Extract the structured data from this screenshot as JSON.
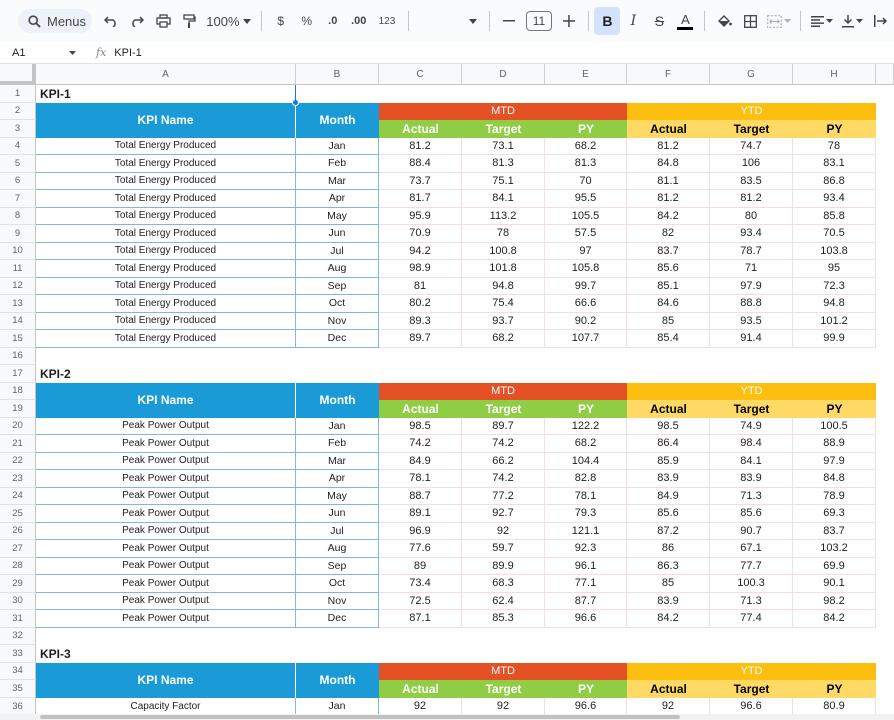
{
  "toolbar": {
    "menus_label": "Menus",
    "zoom": "100%",
    "currency": "$",
    "percent": "%",
    "dec_decrease": ".0",
    "dec_increase": ".00",
    "num_format": "123",
    "font_size": "11",
    "bold": "B",
    "italic": "I",
    "strike": "S",
    "text_color": "A",
    "icons": [
      "search-icon",
      "undo-icon",
      "redo-icon",
      "print-icon",
      "paint-format-icon",
      "zoom-dropdown-icon",
      "font-dropdown-icon",
      "minus-icon",
      "plus-icon",
      "fill-color-icon",
      "borders-icon",
      "merge-icon",
      "align-icon",
      "valign-icon",
      "text-rotation-icon"
    ]
  },
  "formula_bar": {
    "cell_ref": "A1",
    "fx": "fx",
    "content": "KPI-1"
  },
  "columns": [
    "A",
    "B",
    "C",
    "D",
    "E",
    "F",
    "G",
    "H"
  ],
  "rows": [
    "1",
    "2",
    "3",
    "4",
    "5",
    "6",
    "7",
    "8",
    "9",
    "10",
    "11",
    "12",
    "13",
    "14",
    "15",
    "16",
    "17",
    "18",
    "19",
    "20",
    "21",
    "22",
    "23",
    "24",
    "25",
    "26",
    "27",
    "28",
    "29",
    "30",
    "31",
    "32",
    "33",
    "34",
    "35",
    "36"
  ],
  "headers": {
    "kpi_name": "KPI Name",
    "month": "Month",
    "mtd": "MTD",
    "ytd": "YTD",
    "actual": "Actual",
    "target": "Target",
    "py": "PY"
  },
  "blocks": [
    {
      "title": "KPI-1",
      "rows": [
        {
          "name": "Total Energy Produced",
          "month": "Jan",
          "v": [
            "81.2",
            "73.1",
            "68.2",
            "81.2",
            "74.7",
            "78"
          ]
        },
        {
          "name": "Total Energy Produced",
          "month": "Feb",
          "v": [
            "88.4",
            "81.3",
            "81.3",
            "84.8",
            "106",
            "83.1"
          ]
        },
        {
          "name": "Total Energy Produced",
          "month": "Mar",
          "v": [
            "73.7",
            "75.1",
            "70",
            "81.1",
            "83.5",
            "86.8"
          ]
        },
        {
          "name": "Total Energy Produced",
          "month": "Apr",
          "v": [
            "81.7",
            "84.1",
            "95.5",
            "81.2",
            "81.2",
            "93.4"
          ]
        },
        {
          "name": "Total Energy Produced",
          "month": "May",
          "v": [
            "95.9",
            "113.2",
            "105.5",
            "84.2",
            "80",
            "85.8"
          ]
        },
        {
          "name": "Total Energy Produced",
          "month": "Jun",
          "v": [
            "70.9",
            "78",
            "57.5",
            "82",
            "93.4",
            "70.5"
          ]
        },
        {
          "name": "Total Energy Produced",
          "month": "Jul",
          "v": [
            "94.2",
            "100.8",
            "97",
            "83.7",
            "78.7",
            "103.8"
          ]
        },
        {
          "name": "Total Energy Produced",
          "month": "Aug",
          "v": [
            "98.9",
            "101.8",
            "105.8",
            "85.6",
            "71",
            "95"
          ]
        },
        {
          "name": "Total Energy Produced",
          "month": "Sep",
          "v": [
            "81",
            "94.8",
            "99.7",
            "85.1",
            "97.9",
            "72.3"
          ]
        },
        {
          "name": "Total Energy Produced",
          "month": "Oct",
          "v": [
            "80.2",
            "75.4",
            "66.6",
            "84.6",
            "88.8",
            "94.8"
          ]
        },
        {
          "name": "Total Energy Produced",
          "month": "Nov",
          "v": [
            "89.3",
            "93.7",
            "90.2",
            "85",
            "93.5",
            "101.2"
          ]
        },
        {
          "name": "Total Energy Produced",
          "month": "Dec",
          "v": [
            "89.7",
            "68.2",
            "107.7",
            "85.4",
            "91.4",
            "99.9"
          ]
        }
      ]
    },
    {
      "title": "KPI-2",
      "rows": [
        {
          "name": "Peak Power Output",
          "month": "Jan",
          "v": [
            "98.5",
            "89.7",
            "122.2",
            "98.5",
            "74.9",
            "100.5"
          ]
        },
        {
          "name": "Peak Power Output",
          "month": "Feb",
          "v": [
            "74.2",
            "74.2",
            "68.2",
            "86.4",
            "98.4",
            "88.9"
          ]
        },
        {
          "name": "Peak Power Output",
          "month": "Mar",
          "v": [
            "84.9",
            "66.2",
            "104.4",
            "85.9",
            "84.1",
            "97.9"
          ]
        },
        {
          "name": "Peak Power Output",
          "month": "Apr",
          "v": [
            "78.1",
            "74.2",
            "82.8",
            "83.9",
            "83.9",
            "84.8"
          ]
        },
        {
          "name": "Peak Power Output",
          "month": "May",
          "v": [
            "88.7",
            "77.2",
            "78.1",
            "84.9",
            "71.3",
            "78.9"
          ]
        },
        {
          "name": "Peak Power Output",
          "month": "Jun",
          "v": [
            "89.1",
            "92.7",
            "79.3",
            "85.6",
            "85.6",
            "69.3"
          ]
        },
        {
          "name": "Peak Power Output",
          "month": "Jul",
          "v": [
            "96.9",
            "92",
            "121.1",
            "87.2",
            "90.7",
            "83.7"
          ]
        },
        {
          "name": "Peak Power Output",
          "month": "Aug",
          "v": [
            "77.6",
            "59.7",
            "92.3",
            "86",
            "67.1",
            "103.2"
          ]
        },
        {
          "name": "Peak Power Output",
          "month": "Sep",
          "v": [
            "89",
            "89.9",
            "96.1",
            "86.3",
            "77.7",
            "69.9"
          ]
        },
        {
          "name": "Peak Power Output",
          "month": "Oct",
          "v": [
            "73.4",
            "68.3",
            "77.1",
            "85",
            "100.3",
            "90.1"
          ]
        },
        {
          "name": "Peak Power Output",
          "month": "Nov",
          "v": [
            "72.5",
            "62.4",
            "87.7",
            "83.9",
            "71.3",
            "98.2"
          ]
        },
        {
          "name": "Peak Power Output",
          "month": "Dec",
          "v": [
            "87.1",
            "85.3",
            "96.6",
            "84.2",
            "77.4",
            "84.2"
          ]
        }
      ]
    },
    {
      "title": "KPI-3",
      "rows": [
        {
          "name": "Capacity Factor",
          "month": "Jan",
          "v": [
            "92",
            "92",
            "96.6",
            "92",
            "96.6",
            "80.9"
          ]
        }
      ]
    }
  ]
}
